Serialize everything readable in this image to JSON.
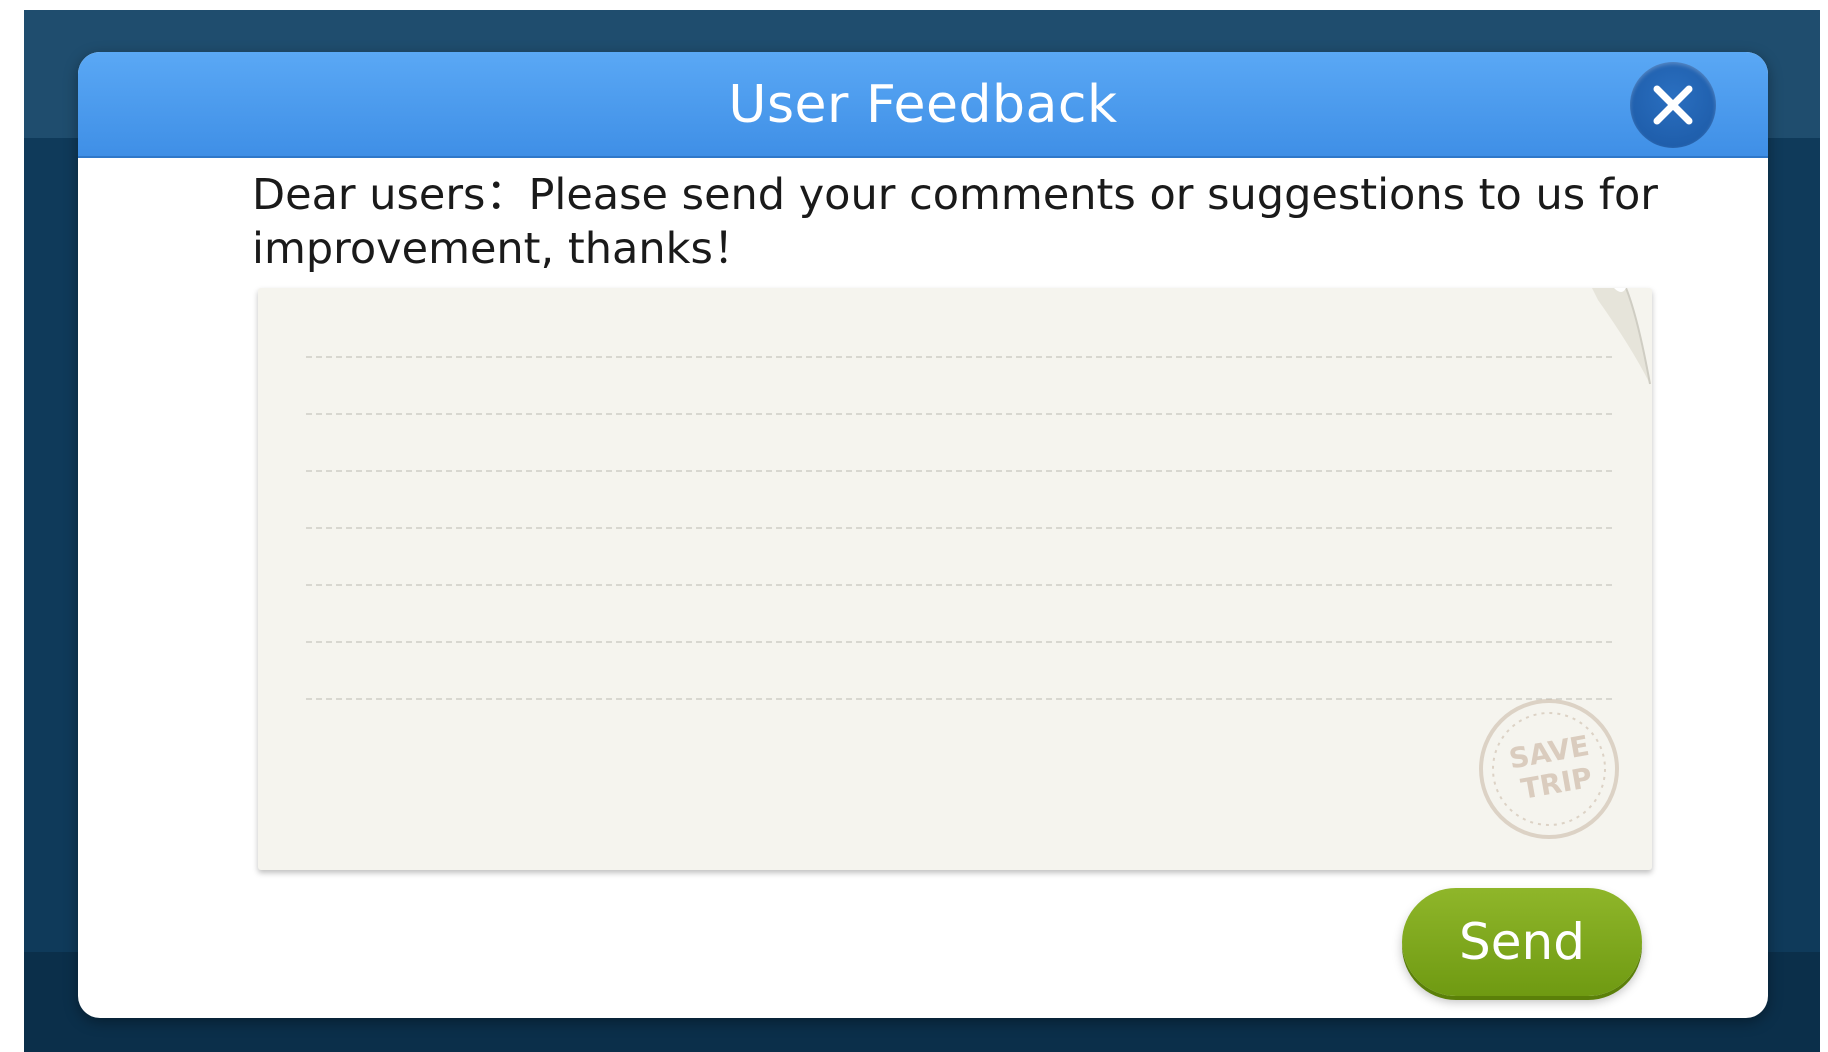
{
  "dialog": {
    "title": "User Feedback",
    "close_icon": "close-icon",
    "intro_text": "Dear users：Please send your comments or suggestions to us for\nimprovement, thanks！",
    "feedback_input": {
      "value": "",
      "placeholder": ""
    },
    "stamp_text": "SAVE TRIP",
    "send_label": "Send"
  },
  "colors": {
    "header_blue": "#4a9aee",
    "close_button_blue": "#1f5fae",
    "send_green": "#7fa81d",
    "background_navy": "#0f3a5a",
    "note_paper": "#f5f4ee"
  }
}
